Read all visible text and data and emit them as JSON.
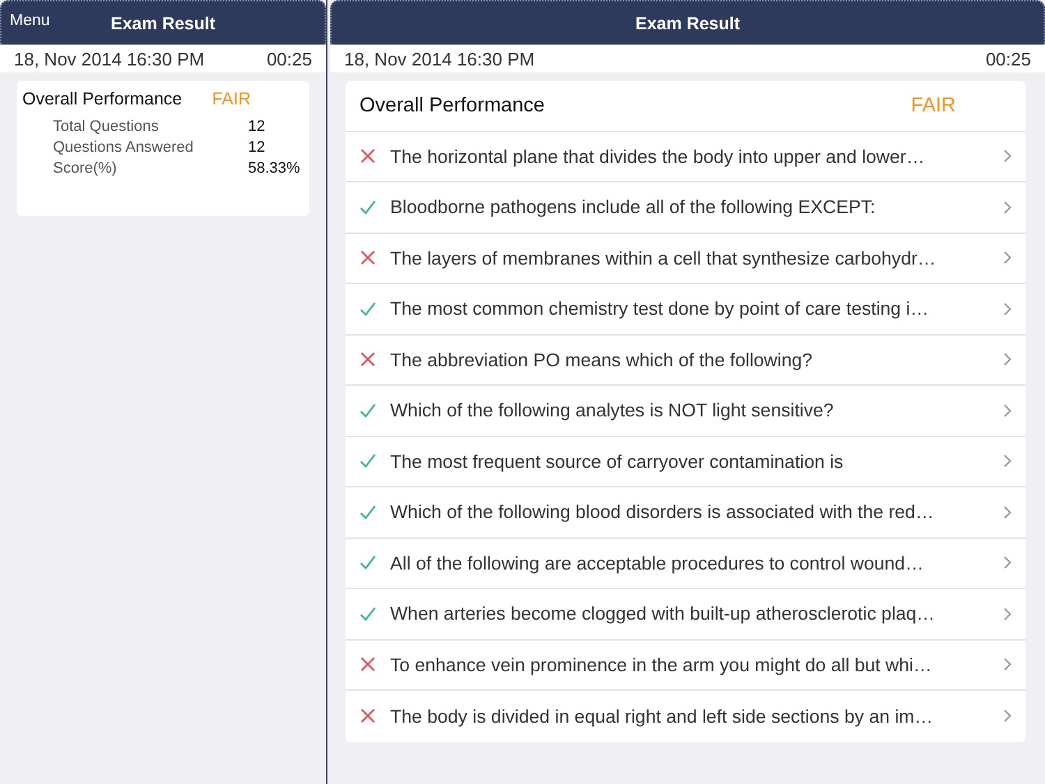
{
  "left_pane": {
    "menu_button": "Menu",
    "title": "Exam Result",
    "date": "18, Nov 2014 16:30 PM",
    "duration": "00:25",
    "summary": {
      "label": "Overall Performance",
      "rating": "FAIR",
      "stats": [
        {
          "label": "Total Questions",
          "value": "12"
        },
        {
          "label": "Questions Answered",
          "value": "12"
        },
        {
          "label": "Score(%)",
          "value": "58.33%"
        }
      ]
    }
  },
  "right_pane": {
    "title": "Exam Result",
    "date": "18, Nov 2014 16:30 PM",
    "duration": "00:25",
    "summary": {
      "label": "Overall Performance",
      "rating": "FAIR"
    },
    "questions": [
      {
        "text": "The horizontal plane that divides the body into upper and lower…",
        "correct": false
      },
      {
        "text": "Bloodborne pathogens include all of the following EXCEPT:",
        "correct": true
      },
      {
        "text": "The layers of membranes within a cell that synthesize carbohydr…",
        "correct": false
      },
      {
        "text": "The most common chemistry test done by point of care testing i…",
        "correct": true
      },
      {
        "text": "The abbreviation PO means which of the following?",
        "correct": false
      },
      {
        "text": "Which of the following analytes is NOT light sensitive?",
        "correct": true
      },
      {
        "text": "The most frequent source of carryover contamination is",
        "correct": true
      },
      {
        "text": "Which of the following blood disorders is associated with the red…",
        "correct": true
      },
      {
        "text": "All of the following are acceptable procedures to control wound…",
        "correct": true
      },
      {
        "text": "When arteries become clogged with built-up atherosclerotic plaq…",
        "correct": true
      },
      {
        "text": "To enhance vein prominence in the arm you might do all but whi…",
        "correct": false
      },
      {
        "text": "The body is divided in equal right and left side sections by an im…",
        "correct": false
      }
    ]
  }
}
